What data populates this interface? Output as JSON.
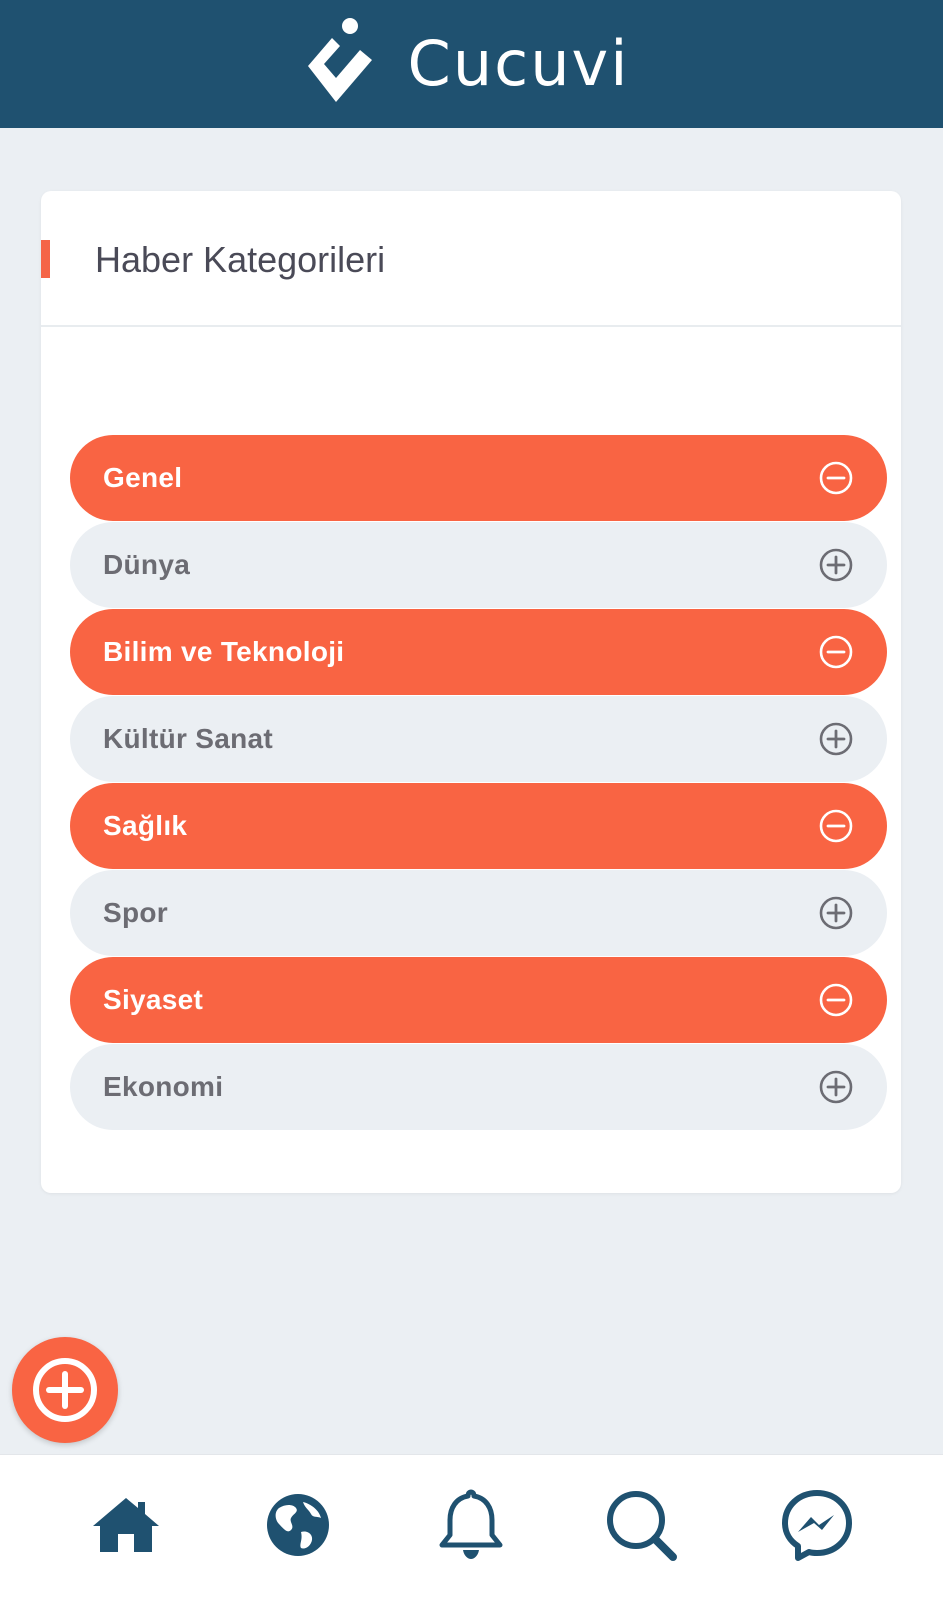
{
  "app": {
    "name": "Cucuvi"
  },
  "colors": {
    "header_bg": "#1f5170",
    "accent": "#f96443",
    "page_bg": "#ebeff3",
    "icon_dark": "#1f5170"
  },
  "card": {
    "title": "Haber Kategorileri"
  },
  "categories": [
    {
      "label": "Genel",
      "selected": true,
      "icon": "minus-circle-icon"
    },
    {
      "label": "Dünya",
      "selected": false,
      "icon": "plus-circle-icon"
    },
    {
      "label": "Bilim ve Teknoloji",
      "selected": true,
      "icon": "minus-circle-icon"
    },
    {
      "label": "Kültür Sanat",
      "selected": false,
      "icon": "plus-circle-icon"
    },
    {
      "label": "Sağlık",
      "selected": true,
      "icon": "minus-circle-icon"
    },
    {
      "label": "Spor",
      "selected": false,
      "icon": "plus-circle-icon"
    },
    {
      "label": "Siyaset",
      "selected": true,
      "icon": "minus-circle-icon"
    },
    {
      "label": "Ekonomi",
      "selected": false,
      "icon": "plus-circle-icon"
    }
  ],
  "fab": {
    "icon": "plus-circle-icon"
  },
  "bottom_nav": [
    {
      "icon": "home-icon"
    },
    {
      "icon": "globe-icon"
    },
    {
      "icon": "bell-icon"
    },
    {
      "icon": "search-icon"
    },
    {
      "icon": "messenger-icon"
    }
  ]
}
